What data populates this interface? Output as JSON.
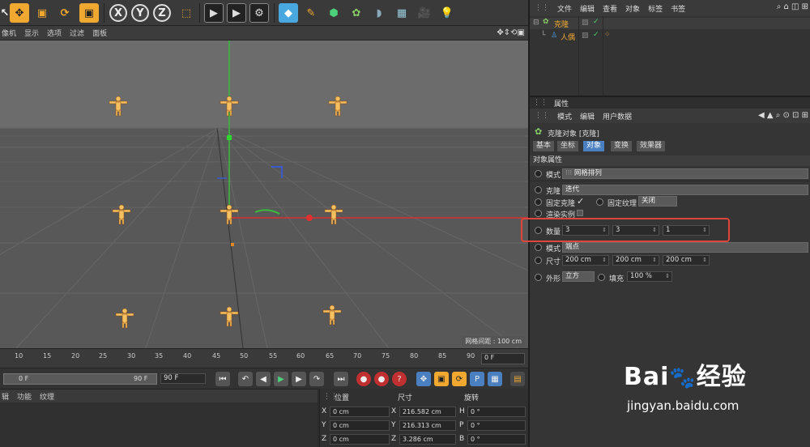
{
  "toolbar": {
    "axis_x": "X",
    "axis_y": "Y",
    "axis_z": "Z"
  },
  "viewport_menu": [
    "像机",
    "显示",
    "选项",
    "过滤",
    "面板"
  ],
  "viewport": {
    "grid_spacing": "网格间距 : 100 cm"
  },
  "timeline": {
    "ticks": [
      "10",
      "15",
      "20",
      "25",
      "30",
      "35",
      "40",
      "45",
      "50",
      "55",
      "60",
      "65",
      "70",
      "75",
      "80",
      "85",
      "90"
    ],
    "current_frame": "0 F",
    "start": "0 F",
    "end_inner": "90 F",
    "end": "90 F"
  },
  "material_menu": [
    "辑",
    "功能",
    "纹理"
  ],
  "coords": {
    "headers": {
      "position": "位置",
      "size": "尺寸",
      "rotation": "旋转"
    },
    "rows": [
      {
        "axis": "X",
        "pos": "0 cm",
        "size_axis": "X",
        "size": "216.582 cm",
        "rot_axis": "H",
        "rot": "0 °"
      },
      {
        "axis": "Y",
        "pos": "0 cm",
        "size_axis": "Y",
        "size": "216.313 cm",
        "rot_axis": "P",
        "rot": "0 °"
      },
      {
        "axis": "Z",
        "pos": "0 cm",
        "size_axis": "Z",
        "size": "3.286 cm",
        "rot_axis": "B",
        "rot": "0 °"
      }
    ]
  },
  "object_manager": {
    "menu": [
      "文件",
      "编辑",
      "查看",
      "对象",
      "标签",
      "书签"
    ],
    "objects": [
      {
        "name": "克隆"
      },
      {
        "name": "人偶"
      }
    ]
  },
  "attributes": {
    "title": "属性",
    "menu": [
      "模式",
      "编辑",
      "用户数据"
    ],
    "object_title": "克隆对象 [克隆]",
    "tabs": [
      "基本",
      "坐标",
      "对象",
      "变换",
      "效果器"
    ],
    "active_tab": "对象",
    "section": "对象属性",
    "mode_label": "模式",
    "mode_value": "网格排列",
    "clone_label": "克隆",
    "clone_value": "迭代",
    "fix_clone_label": "固定克隆",
    "fix_clone_check": "✓",
    "fix_texture_label": "固定纹理",
    "fix_texture_value": "关闭",
    "render_instance_label": "渲染实例",
    "count_label": "数量",
    "count": [
      "3",
      "3",
      "1"
    ],
    "mode2_label": "模式",
    "mode2_value": "端点",
    "size_label": "尺寸",
    "size": [
      "200 cm",
      "200 cm",
      "200 cm"
    ],
    "shape_label": "外形",
    "shape_value": "立方",
    "fill_label": "填充",
    "fill_value": "100 %"
  },
  "watermark": {
    "brand": "Bai",
    "brand2": "经验",
    "url": "jingyan.baidu.com"
  },
  "colors": {
    "accent": "#f0a830",
    "tab_active": "#4a7fc0",
    "highlight": "#e0453a"
  }
}
